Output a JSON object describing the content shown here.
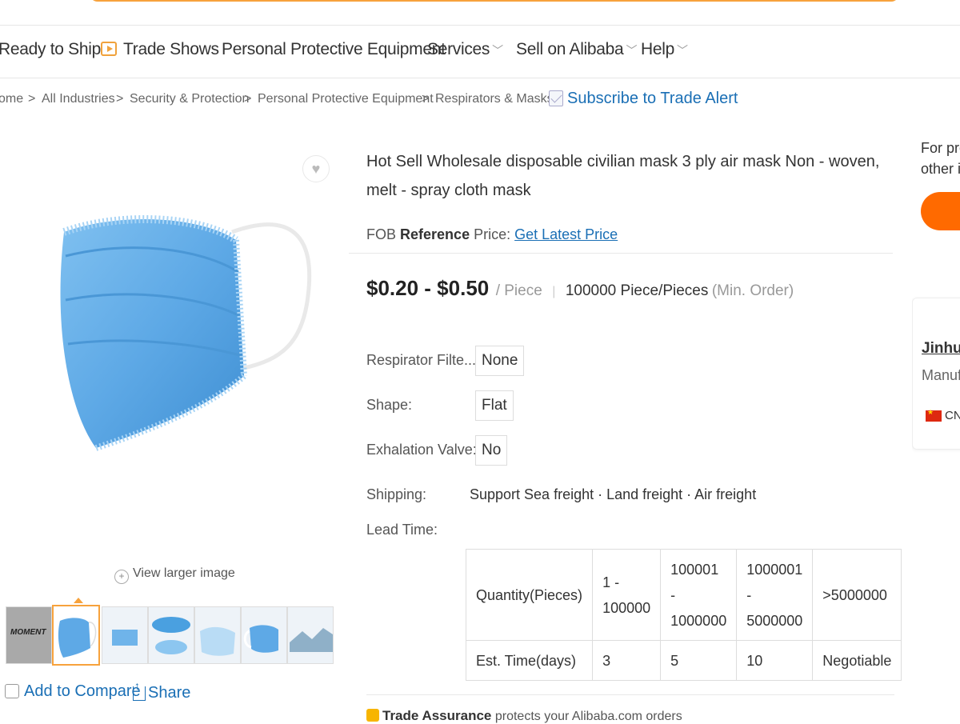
{
  "nav": {
    "items": [
      {
        "label": "Ready to Ship",
        "chevron": false,
        "icon": null
      },
      {
        "label": "Trade Shows",
        "chevron": false,
        "icon": "play-icon"
      },
      {
        "label": "Personal Protective Equipment",
        "chevron": false,
        "icon": null
      },
      {
        "label": "Services",
        "chevron": true,
        "icon": null
      },
      {
        "label": "Sell on Alibaba",
        "chevron": true,
        "icon": null
      },
      {
        "label": "Help",
        "chevron": true,
        "icon": null
      }
    ]
  },
  "breadcrumb": {
    "items": [
      "ome",
      "All Industries",
      "Security & Protection",
      "Personal Protective Equipment",
      "Respirators & Masks"
    ],
    "separator": ">",
    "subscribe_label": "Subscribe to Trade Alert"
  },
  "gallery": {
    "view_larger_label": "View larger image",
    "thumb_first_label": "MOMENT",
    "add_to_compare_label": "Add to Compare",
    "share_label": "Share"
  },
  "product": {
    "title": "Hot Sell Wholesale disposable civilian mask 3 ply air mask Non - woven, melt - spray cloth mask",
    "fob_prefix": "FOB",
    "fob_bold": "Reference",
    "fob_suffix": "Price:",
    "fob_link": "Get Latest Price",
    "price_range": "$0.20 - $0.50",
    "price_unit": "/ Piece",
    "min_order_qty": "100000 Piece/Pieces",
    "min_order_tail": "(Min. Order)",
    "attributes": [
      {
        "label": "Respirator Filte...",
        "value": "None"
      },
      {
        "label": "Shape:",
        "value": "Flat"
      },
      {
        "label": "Exhalation Valve:",
        "value": "No"
      }
    ],
    "shipping_label": "Shipping:",
    "shipping_value": "Support Sea freight · Land freight · Air freight",
    "lead_time_label": "Lead Time:",
    "lead_table": {
      "row_quantity_label": "Quantity(Pieces)",
      "row_time_label": "Est. Time(days)",
      "quantities": [
        [
          "1 -",
          "100000"
        ],
        [
          "100001 -",
          "1000000"
        ],
        [
          "1000001",
          "-",
          "5000000"
        ],
        [
          ">5000000"
        ]
      ],
      "times": [
        "3",
        "5",
        "10",
        "Negotiable"
      ]
    },
    "trade_assurance_bold": "Trade Assurance",
    "trade_assurance_text": "protects your Alibaba.com orders"
  },
  "right_panel": {
    "hint_line1": "For pro",
    "hint_line2": "other i",
    "supplier_name": "Jinhua",
    "supplier_type": "Manuf",
    "country_code": "CN"
  },
  "colors": {
    "accent_orange": "#ff6a00",
    "link_blue": "#1a6fb5",
    "search_border": "#f7a23c",
    "mask_blue": "#5ea9e6"
  }
}
